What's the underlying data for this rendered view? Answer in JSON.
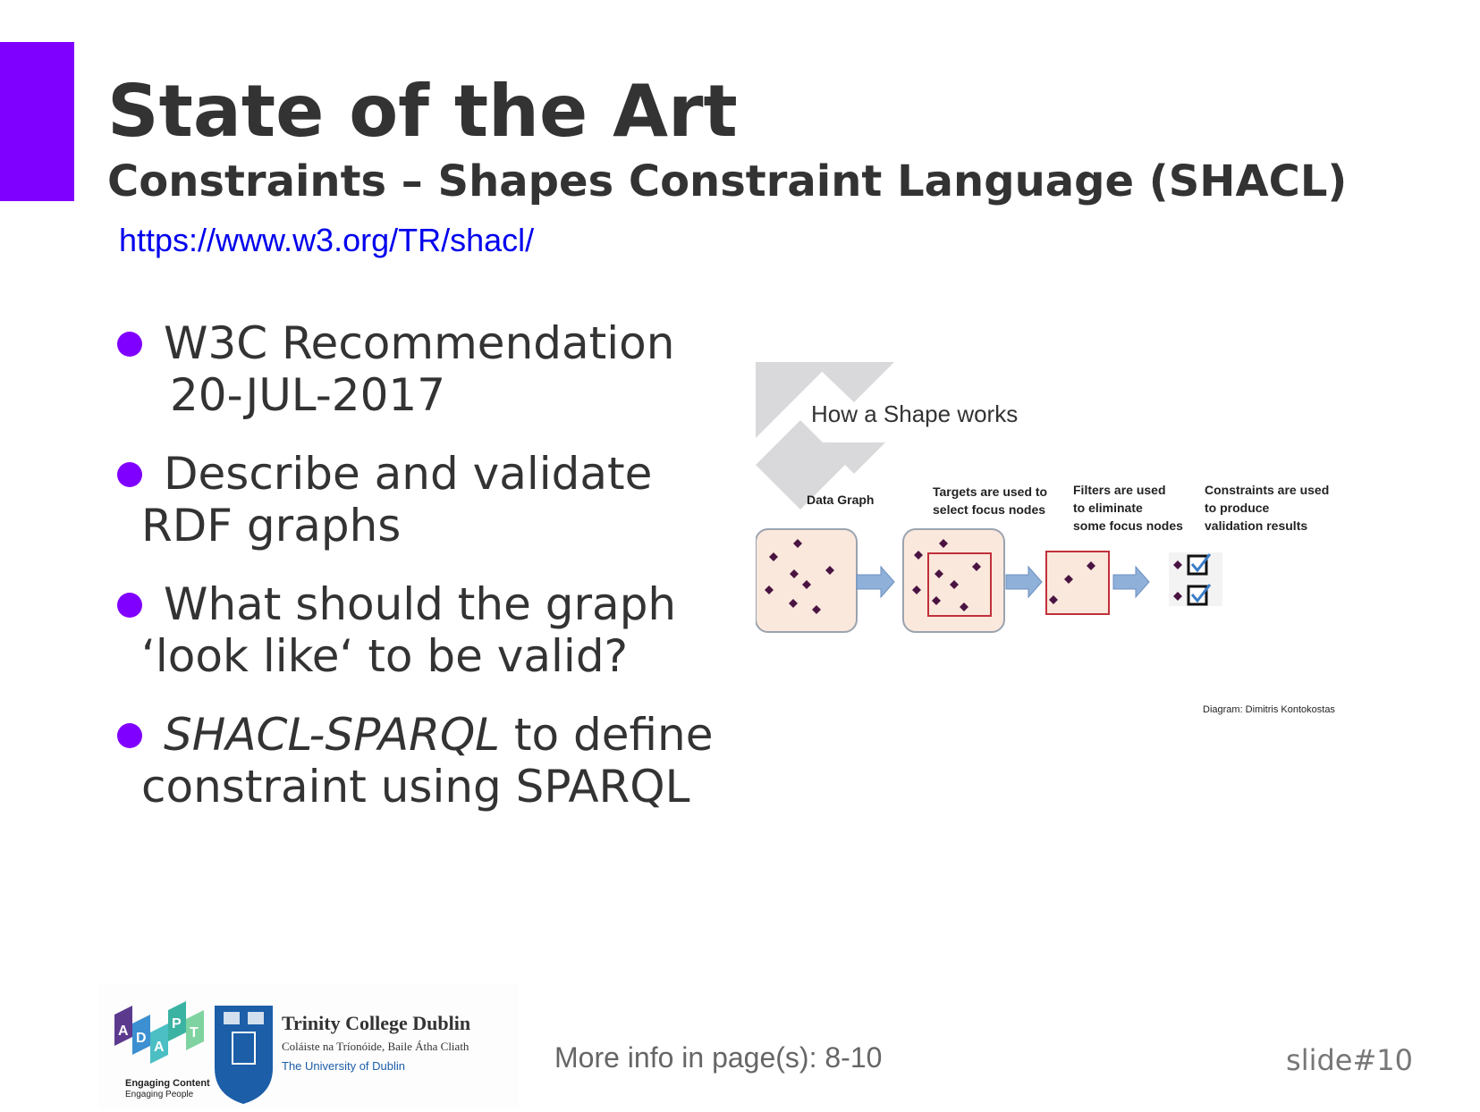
{
  "title": "State of the Art",
  "subtitle": "Constraints – Shapes Constraint Language (SHACL)",
  "link": "https://www.w3.org/TR/shacl/",
  "bullets": [
    {
      "line1": "W3C Recommendation",
      "line2": "20-JUL-2017"
    },
    {
      "line1": "Describe and validate",
      "line2": "RDF graphs"
    },
    {
      "line1": "What should the graph",
      "line2": "‘look like‘ to be valid?"
    },
    {
      "line1_italic": "SHACL-SPARQL",
      "line1_rest": " to define",
      "line2": "constraint using SPARQL"
    }
  ],
  "diagram": {
    "title": "How a Shape works",
    "stage1": "Data Graph",
    "stage2": [
      "Targets are used to",
      "select focus nodes"
    ],
    "stage3": [
      "Filters are used",
      "to eliminate",
      "some focus nodes"
    ],
    "stage4": [
      "Constraints are used",
      "to produce",
      "validation results"
    ],
    "credit": "Diagram: Dimitris Kontokostas"
  },
  "logos": {
    "adapt_letters": [
      "A",
      "D",
      "A",
      "P",
      "T"
    ],
    "adapt_tag1": "Engaging Content",
    "adapt_tag2": "Engaging People",
    "tcd_name": "Trinity College Dublin",
    "tcd_irish": "Coláiste na Tríonóide, Baile Átha Cliath",
    "tcd_sub": "The University of Dublin"
  },
  "footer": {
    "more_info": "More info in page(s): 8-10",
    "slide": "slide#10"
  },
  "colors": {
    "accent": "#8000ff",
    "link": "#0000ee",
    "text": "#333333",
    "box_fill": "#fbe8dc",
    "arrow": "#8fb0d8",
    "node": "#4a1442",
    "red_frame": "#c0303a"
  }
}
